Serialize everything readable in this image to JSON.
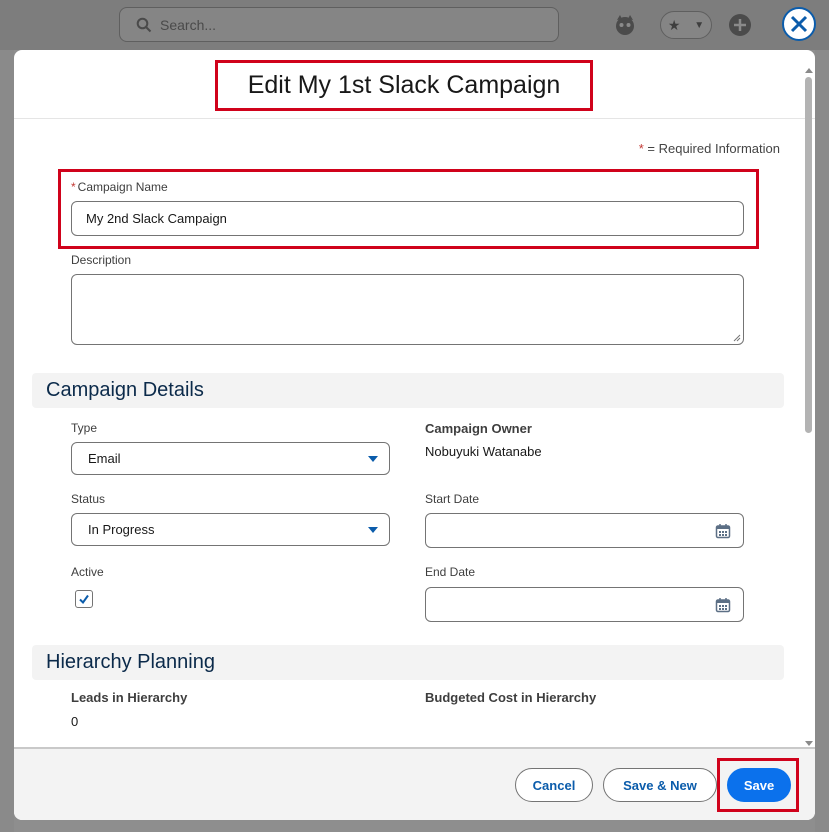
{
  "background": {
    "search_placeholder": "Search..."
  },
  "modal": {
    "title": "Edit My 1st Slack Campaign",
    "required_info": "= Required Information",
    "required_star": "*"
  },
  "campaign_name": {
    "label": "Campaign Name",
    "value": "My 2nd Slack Campaign"
  },
  "description": {
    "label": "Description",
    "value": ""
  },
  "sections": {
    "details_title": "Campaign Details",
    "hierarchy_title": "Hierarchy Planning"
  },
  "details": {
    "type_label": "Type",
    "type_value": "Email",
    "status_label": "Status",
    "status_value": "In Progress",
    "active_label": "Active",
    "active_checked": true,
    "owner_label": "Campaign Owner",
    "owner_value": "Nobuyuki Watanabe",
    "start_date_label": "Start Date",
    "start_date_value": "",
    "end_date_label": "End Date",
    "end_date_value": ""
  },
  "hierarchy": {
    "leads_label": "Leads in Hierarchy",
    "leads_value": "0",
    "budget_label": "Budgeted Cost in Hierarchy",
    "budget_value": ""
  },
  "footer": {
    "cancel_label": "Cancel",
    "save_new_label": "Save & New",
    "save_label": "Save"
  },
  "colors": {
    "brand": "#0b71ec",
    "highlight": "#d0021b",
    "required": "#c23934"
  }
}
